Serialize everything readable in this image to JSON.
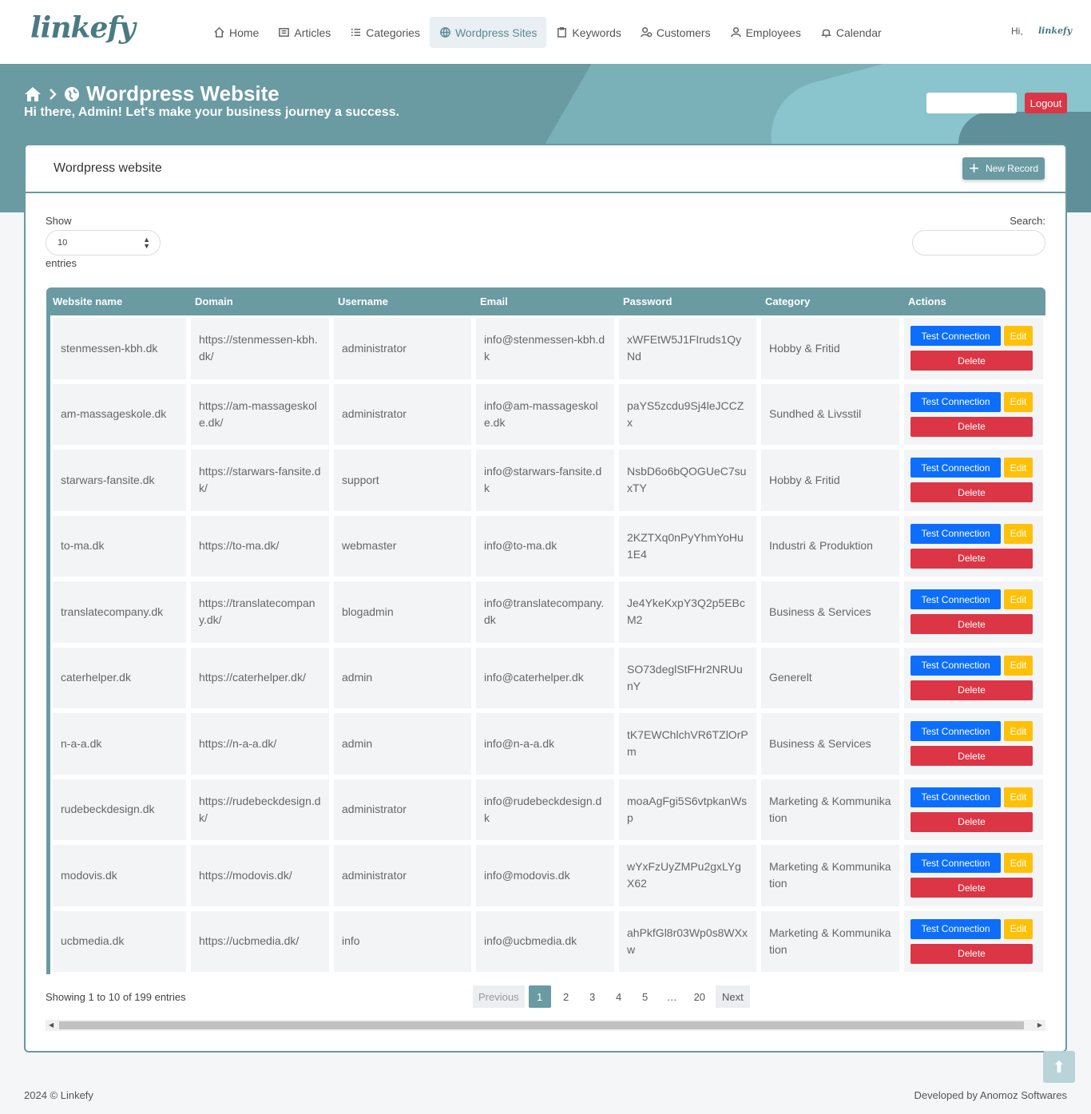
{
  "brand": "linkefy",
  "nav": [
    {
      "label": "Home",
      "icon": "home-icon"
    },
    {
      "label": "Articles",
      "icon": "articles-icon"
    },
    {
      "label": "Categories",
      "icon": "categories-icon"
    },
    {
      "label": "Wordpress Sites",
      "icon": "globe-icon",
      "active": true
    },
    {
      "label": "Keywords",
      "icon": "clipboard-icon"
    },
    {
      "label": "Customers",
      "icon": "customers-icon"
    },
    {
      "label": "Employees",
      "icon": "user-icon"
    },
    {
      "label": "Calendar",
      "icon": "bell-icon"
    }
  ],
  "greeting": "Hi,",
  "greeting_logo": "linkefy",
  "header": {
    "title": "Wordpress Website",
    "subtitle": "Hi there, Admin! Let's make your business journey a success.",
    "logout": "Logout"
  },
  "card": {
    "title": "Wordpress website",
    "new_record": "New Record"
  },
  "controls": {
    "show_label": "Show",
    "show_value": "10",
    "entries_label": "entries",
    "search_label": "Search:"
  },
  "table": {
    "columns": [
      "Website name",
      "Domain",
      "Username",
      "Email",
      "Password",
      "Category",
      "Actions"
    ],
    "rows": [
      {
        "name": "stenmessen-kbh.dk",
        "domain": "https://stenmessen-kbh.dk/",
        "username": "administrator",
        "email": "info@stenmessen-kbh.dk",
        "password": "xWFEtW5J1FIruds1QyNd",
        "category": "Hobby & Fritid"
      },
      {
        "name": "am-massageskole.dk",
        "domain": "https://am-massageskole.dk/",
        "username": "administrator",
        "email": "info@am-massageskole.dk",
        "password": "paYS5zcdu9Sj4leJCCZx",
        "category": "Sundhed & Livsstil"
      },
      {
        "name": "starwars-fansite.dk",
        "domain": "https://starwars-fansite.dk/",
        "username": "support",
        "email": "info@starwars-fansite.dk",
        "password": "NsbD6o6bQOGUeC7suxTY",
        "category": "Hobby & Fritid"
      },
      {
        "name": "to-ma.dk",
        "domain": "https://to-ma.dk/",
        "username": "webmaster",
        "email": "info@to-ma.dk",
        "password": "2KZTXq0nPyYhmYoHu1E4",
        "category": "Industri & Produktion"
      },
      {
        "name": "translatecompany.dk",
        "domain": "https://translatecompany.dk/",
        "username": "blogadmin",
        "email": "info@translatecompany.dk",
        "password": "Je4YkeKxpY3Q2p5EBcM2",
        "category": "Business & Services"
      },
      {
        "name": "caterhelper.dk",
        "domain": "https://caterhelper.dk/",
        "username": "admin",
        "email": "info@caterhelper.dk",
        "password": "SO73deglStFHr2NRUunY",
        "category": "Generelt"
      },
      {
        "name": "n-a-a.dk",
        "domain": "https://n-a-a.dk/",
        "username": "admin",
        "email": "info@n-a-a.dk",
        "password": "tK7EWChlchVR6TZlOrPm",
        "category": "Business & Services"
      },
      {
        "name": "rudebeckdesign.dk",
        "domain": "https://rudebeckdesign.dk/",
        "username": "administrator",
        "email": "info@rudebeckdesign.dk",
        "password": "moaAgFgi5S6vtpkanWsp",
        "category": "Marketing & Kommunikation"
      },
      {
        "name": "modovis.dk",
        "domain": "https://modovis.dk/",
        "username": "administrator",
        "email": "info@modovis.dk",
        "password": "wYxFzUyZMPu2gxLYgX62",
        "category": "Marketing & Kommunikation"
      },
      {
        "name": "ucbmedia.dk",
        "domain": "https://ucbmedia.dk/",
        "username": "info",
        "email": "info@ucbmedia.dk",
        "password": "ahPkfGl8r03Wp0s8WXxw",
        "category": "Marketing & Kommunikation"
      }
    ],
    "action_labels": {
      "test": "Test Connection",
      "edit": "Edit",
      "delete": "Delete"
    }
  },
  "pagination": {
    "info": "Showing 1 to 10 of 199 entries",
    "previous": "Previous",
    "pages": [
      "1",
      "2",
      "3",
      "4",
      "5",
      "…",
      "20"
    ],
    "current": "1",
    "next": "Next"
  },
  "footer": {
    "copyright": "2024 © Linkefy",
    "developer": "Developed by Anomoz Softwares"
  }
}
